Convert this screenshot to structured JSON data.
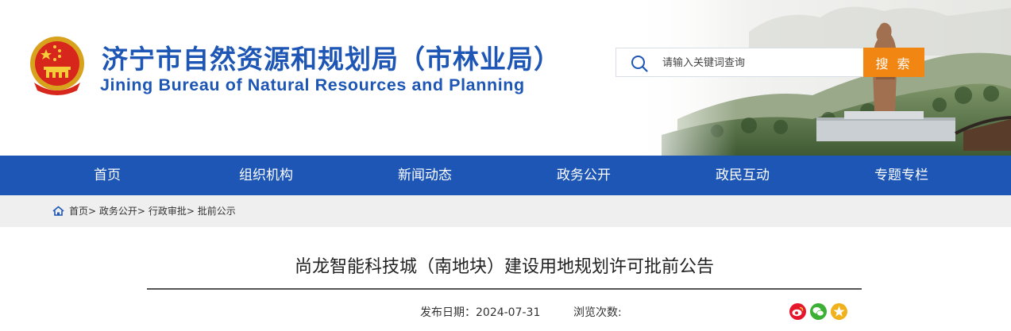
{
  "header": {
    "title_cn": "济宁市自然资源和规划局（市林业局）",
    "title_en": "Jining Bureau of Natural Resources and Planning",
    "emblem_icon": "national-emblem-icon"
  },
  "search": {
    "placeholder": "请输入关键词查询",
    "button_label": "搜 索",
    "icon": "search-icon"
  },
  "nav": {
    "items": [
      {
        "label": "首页"
      },
      {
        "label": "组织机构"
      },
      {
        "label": "新闻动态"
      },
      {
        "label": "政务公开"
      },
      {
        "label": "政民互动"
      },
      {
        "label": "专题专栏"
      }
    ]
  },
  "breadcrumb": {
    "home_icon": "home-icon",
    "items": [
      "首页",
      "政务公开",
      "行政审批",
      "批前公示"
    ],
    "separator": ">"
  },
  "article": {
    "title": "尚龙智能科技城（南地块）建设用地规划许可批前公告",
    "publish_label": "发布日期：",
    "publish_date": "2024-07-31",
    "views_label": "浏览次数:"
  },
  "share": {
    "icons": [
      "weibo-icon",
      "wechat-icon",
      "qzone-icon"
    ]
  },
  "colors": {
    "brand_blue": "#1d56b4",
    "search_orange": "#f28613",
    "breadcrumb_bg": "#efefef",
    "weibo_red": "#e6162d",
    "wechat_green": "#3cb034",
    "qzone_yellow": "#f0b11a"
  }
}
